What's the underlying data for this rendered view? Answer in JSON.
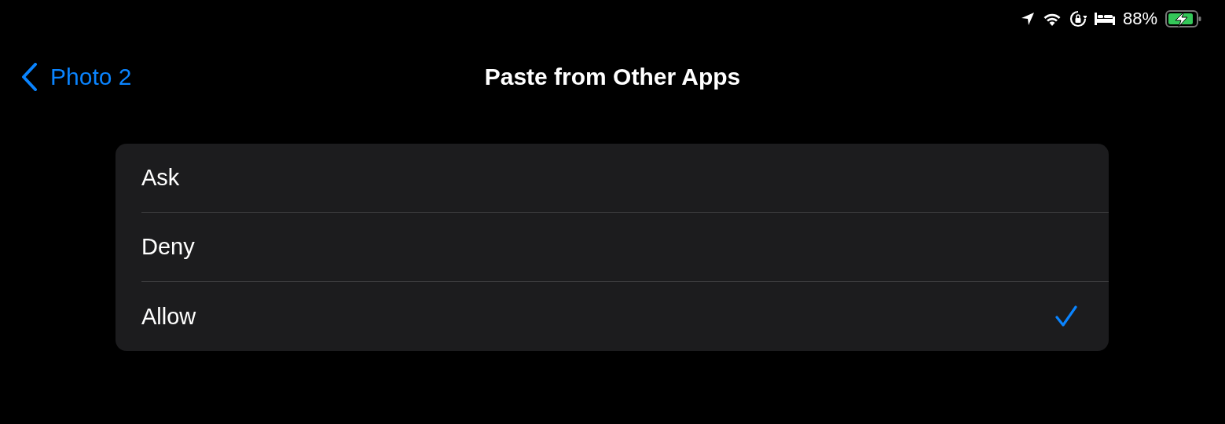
{
  "status_bar": {
    "battery_percent": "88%"
  },
  "nav": {
    "back_label": "Photo 2",
    "title": "Paste from Other Apps"
  },
  "options": [
    {
      "label": "Ask",
      "selected": false
    },
    {
      "label": "Deny",
      "selected": false
    },
    {
      "label": "Allow",
      "selected": true
    }
  ]
}
